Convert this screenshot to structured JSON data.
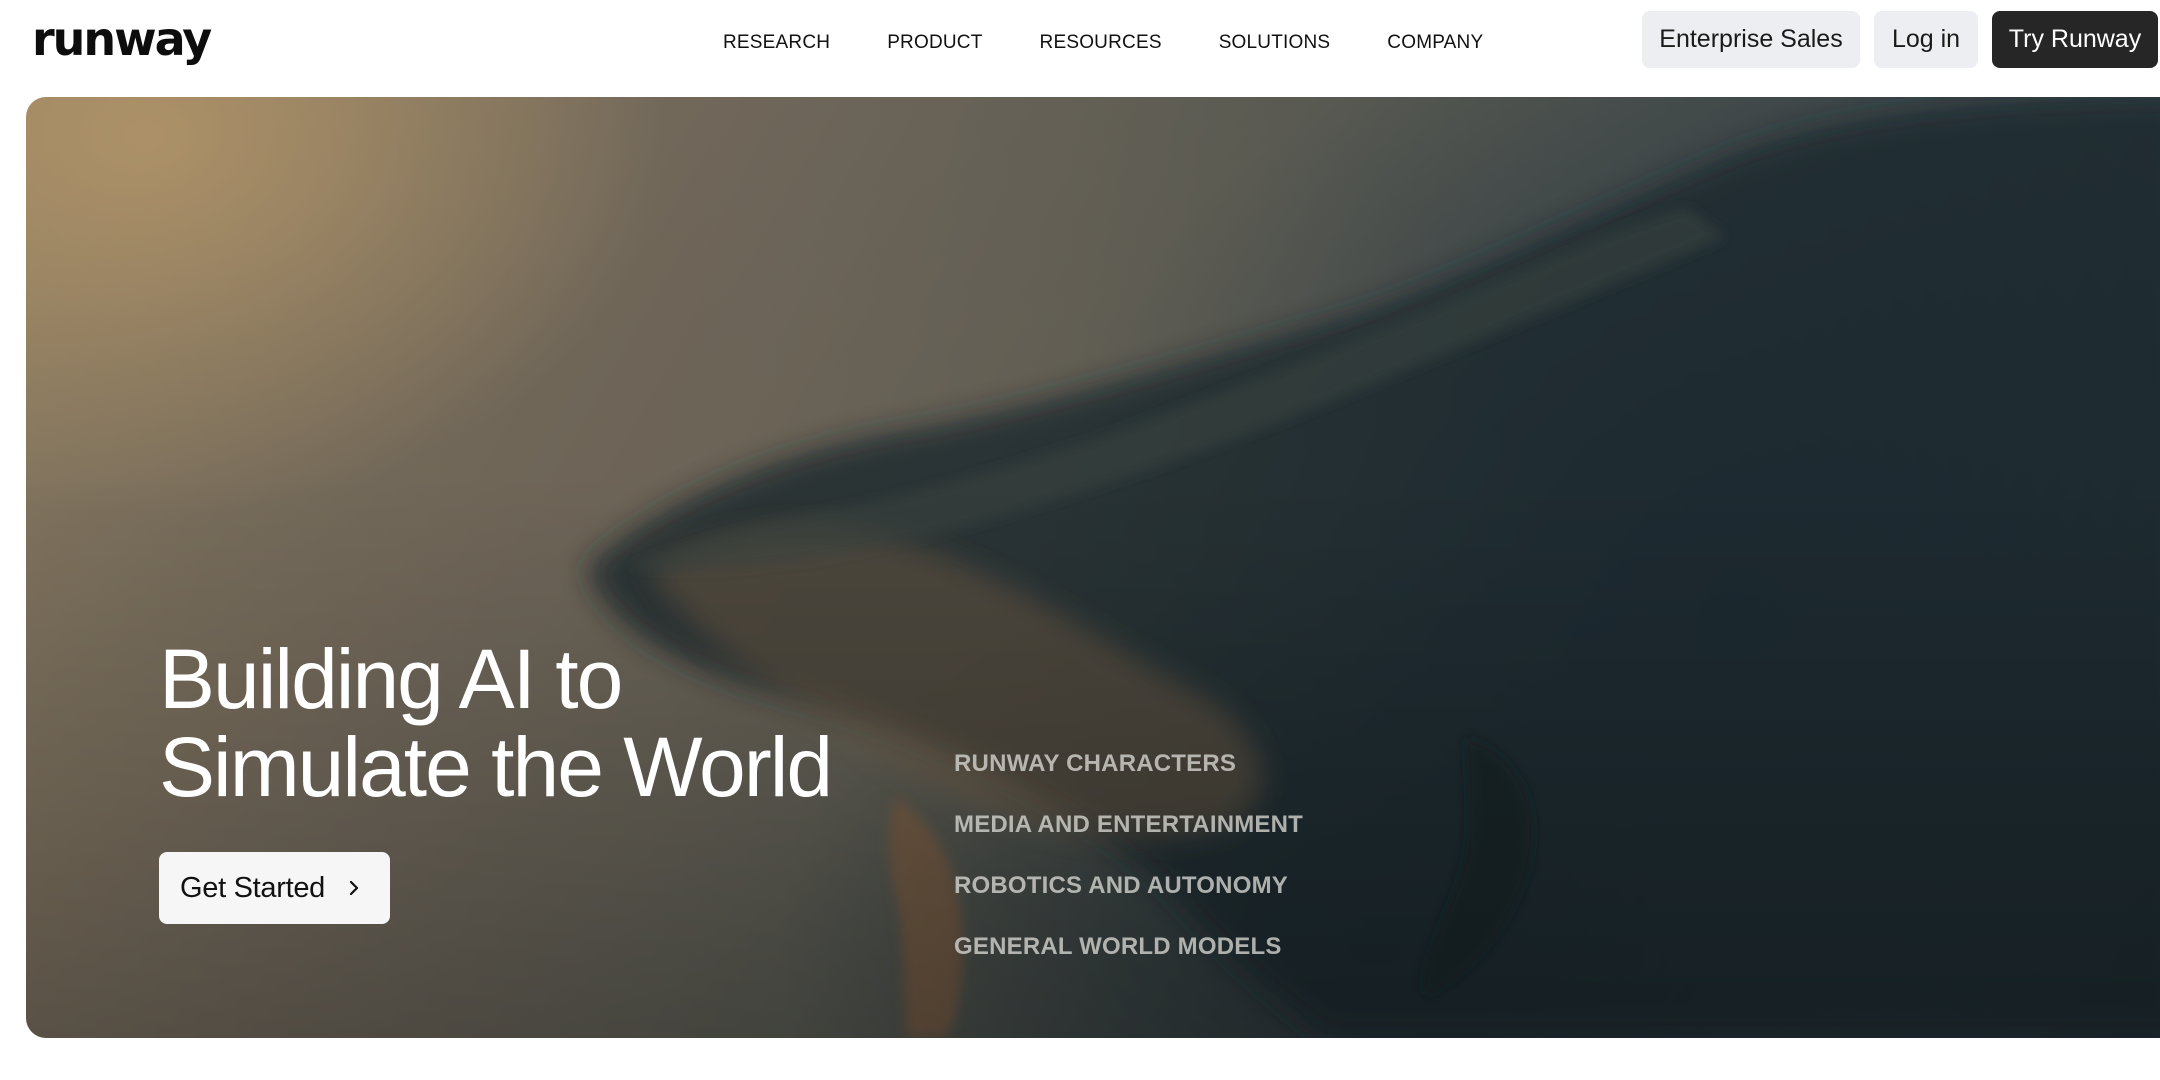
{
  "header": {
    "logo": "runway",
    "nav": [
      "RESEARCH",
      "PRODUCT",
      "RESOURCES",
      "SOLUTIONS",
      "COMPANY"
    ],
    "enterprise_label": "Enterprise Sales",
    "login_label": "Log in",
    "try_label": "Try Runway"
  },
  "hero": {
    "title_line1": "Building AI to",
    "title_line2": "Simulate the World",
    "cta_label": "Get Started",
    "cta_icon": "chevron-right-icon",
    "links": [
      "RUNWAY CHARACTERS",
      "MEDIA AND ENTERTAINMENT",
      "ROBOTICS AND AUTONOMY",
      "GENERAL WORLD MODELS"
    ]
  },
  "colors": {
    "primary_dark": "#262626",
    "secondary_light": "#eceef1",
    "text_white": "#ffffff"
  }
}
